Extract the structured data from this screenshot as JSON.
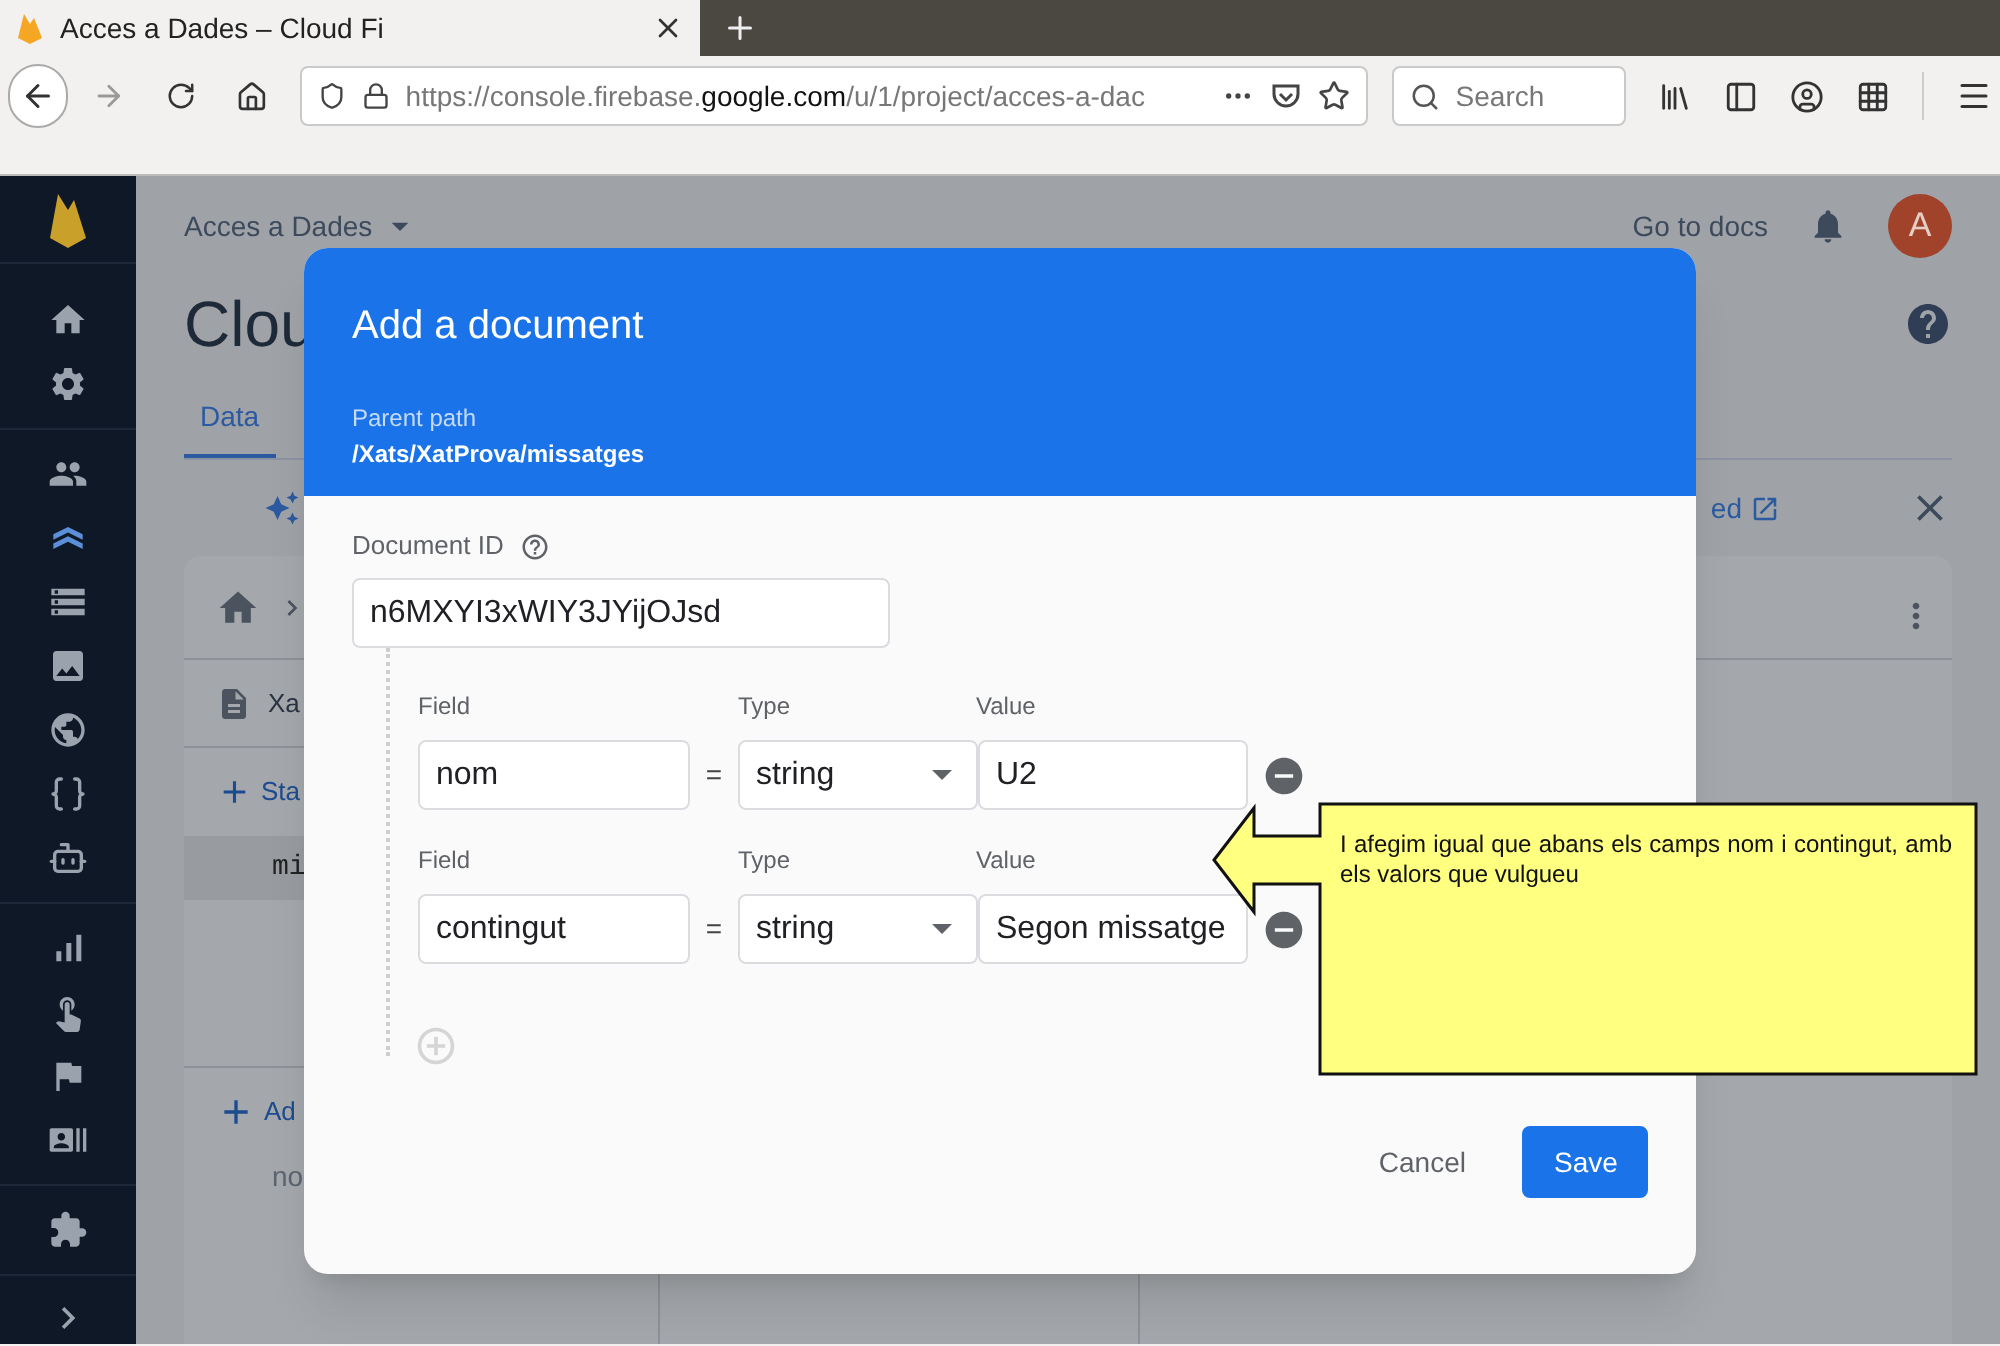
{
  "browser": {
    "tab_title": "Acces a Dades – Cloud Fi",
    "url_prefix": "https://console.firebase.",
    "url_domain": "google.com",
    "url_rest": "/u/1/project/acces-a-dac",
    "search_placeholder": "Search"
  },
  "sidebar": {
    "items": [
      {
        "selected": false
      },
      {
        "selected": false
      },
      {
        "selected": false
      },
      {
        "selected": true
      },
      {
        "selected": false
      },
      {
        "selected": false
      },
      {
        "selected": false
      },
      {
        "selected": false
      },
      {
        "selected": false
      },
      {
        "selected": false
      },
      {
        "selected": false
      },
      {
        "selected": false
      },
      {
        "selected": false
      },
      {
        "selected": false
      }
    ]
  },
  "header": {
    "project": "Acces a Dades",
    "docs_link": "Go to docs",
    "avatar": "A"
  },
  "page": {
    "title": "Clou",
    "tabs": [
      {
        "label": "Data",
        "selected": true
      }
    ],
    "banner_link": "ed",
    "panel": {
      "document": "Xa",
      "start_collection": "Sta",
      "collection_item": "mi",
      "add": "Ad",
      "note": "no"
    }
  },
  "dialog": {
    "title": "Add a document",
    "parent_path_label": "Parent path",
    "parent_path": "/Xats/XatProva/missatges",
    "doc_id_label": "Document ID",
    "doc_id": "n6MXYI3xWIY3JYijOJsd",
    "fields": [
      {
        "field_label": "Field",
        "type_label": "Type",
        "value_label": "Value",
        "name": "nom",
        "operator": "=",
        "type": "string",
        "value": "U2"
      },
      {
        "field_label": "Field",
        "type_label": "Type",
        "value_label": "Value",
        "name": "contingut",
        "operator": "=",
        "type": "string",
        "value": "Segon missatge"
      }
    ],
    "cancel": "Cancel",
    "save": "Save"
  },
  "callout": {
    "text": "I afegim igual que abans els camps nom i contingut, amb els valors que vulgueu"
  }
}
